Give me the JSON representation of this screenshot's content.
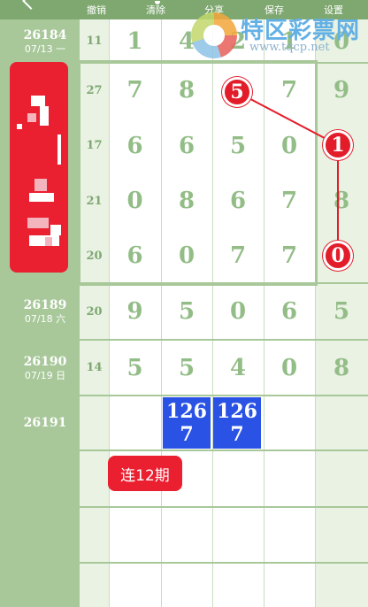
{
  "toolbar": {
    "undo": "撤销",
    "clear": "清除",
    "share": "分享",
    "save": "保存",
    "settings": "设置"
  },
  "watermark": {
    "title": "特区彩票网",
    "url": "www.tqcp.net"
  },
  "colors": {
    "header": "#7ea86f",
    "issue_bg": "#a8c89a",
    "digit": "#93bd87",
    "ball": "#e31c2a",
    "blue": "#2a53e6"
  },
  "rows": [
    {
      "issue": "26184",
      "date": "07/13 一",
      "sum": "11",
      "d": [
        "1",
        "4",
        "2",
        "1",
        "0"
      ]
    },
    {
      "issue": "",
      "date": "",
      "sum": "27",
      "d": [
        "7",
        "8",
        "",
        "7",
        "9"
      ]
    },
    {
      "issue": "",
      "date": "",
      "sum": "17",
      "d": [
        "6",
        "6",
        "5",
        "0",
        ""
      ]
    },
    {
      "issue": "",
      "date": "",
      "sum": "21",
      "d": [
        "0",
        "8",
        "6",
        "7",
        "8"
      ]
    },
    {
      "issue": "",
      "date": "",
      "sum": "20",
      "d": [
        "6",
        "0",
        "7",
        "7",
        ""
      ]
    },
    {
      "issue": "26189",
      "date": "07/18 六",
      "sum": "20",
      "d": [
        "9",
        "5",
        "0",
        "6",
        "5"
      ]
    },
    {
      "issue": "26190",
      "date": "07/19 日",
      "sum": "14",
      "d": [
        "5",
        "5",
        "4",
        "0",
        "8"
      ]
    },
    {
      "issue": "26191",
      "date": "",
      "sum": "",
      "d": [
        "",
        "",
        "",
        "",
        ""
      ]
    },
    {
      "issue": "",
      "date": "",
      "sum": "",
      "d": [
        "",
        "",
        "",
        "",
        ""
      ]
    },
    {
      "issue": "",
      "date": "",
      "sum": "",
      "d": [
        "",
        "",
        "",
        "",
        ""
      ]
    },
    {
      "issue": "",
      "date": "",
      "sum": "",
      "d": [
        "",
        "",
        "",
        "",
        ""
      ]
    }
  ],
  "marks": [
    {
      "value": "5"
    },
    {
      "value": "1"
    },
    {
      "value": "0"
    }
  ],
  "predictions": [
    {
      "line1": "126",
      "line2": "7"
    },
    {
      "line1": "126",
      "line2": "7"
    }
  ],
  "streak_label": "连12期"
}
